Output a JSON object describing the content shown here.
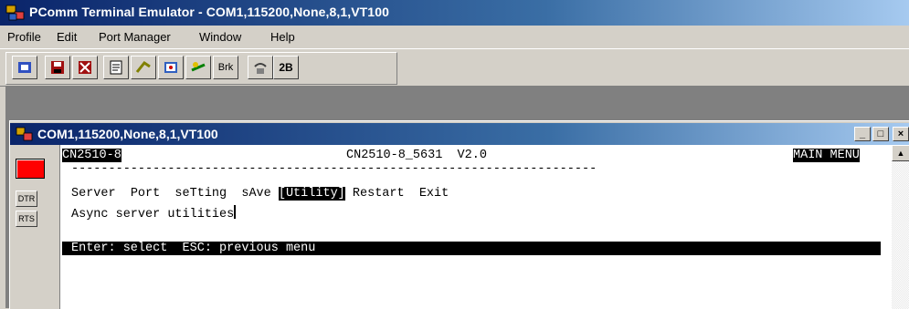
{
  "app": {
    "title": "PComm Terminal Emulator - COM1,115200,None,8,1,VT100"
  },
  "menu": [
    "Profile",
    "Edit",
    "Port Manager",
    "Window",
    "Help"
  ],
  "toolbar": {
    "buttons": [
      {
        "name": "open-icon",
        "label": ""
      },
      {
        "name": "save-icon",
        "label": ""
      },
      {
        "name": "exit-icon",
        "label": ""
      },
      {
        "name": "properties-icon",
        "label": ""
      },
      {
        "name": "paste-icon",
        "label": ""
      },
      {
        "name": "capture-icon",
        "label": ""
      },
      {
        "name": "transfer-icon",
        "label": ""
      },
      {
        "name": "break-button",
        "label": "Brk"
      },
      {
        "name": "dial-icon",
        "label": ""
      },
      {
        "name": "2b-button",
        "label": "2B"
      }
    ]
  },
  "child": {
    "title": "COM1,115200,None,8,1,VT100",
    "min": "_",
    "max": "□",
    "close": "×"
  },
  "leftpanel": {
    "dtr": "DTR",
    "rts": "RTS"
  },
  "terminal": {
    "device": "CN2510-8",
    "version": "CN2510-8_5631  V2.0",
    "menu_title": "MAIN MENU",
    "divider": "-----------------------------------------------------------------------",
    "menu_items": [
      "Server",
      "Port",
      "seTting",
      "sAve",
      "[Utility]",
      "Restart",
      "Exit"
    ],
    "description": "Async server utilities",
    "hint": "Enter: select  ESC: previous menu"
  },
  "colors": {
    "titlebar": "#0a246a",
    "led": "#ff0000"
  }
}
